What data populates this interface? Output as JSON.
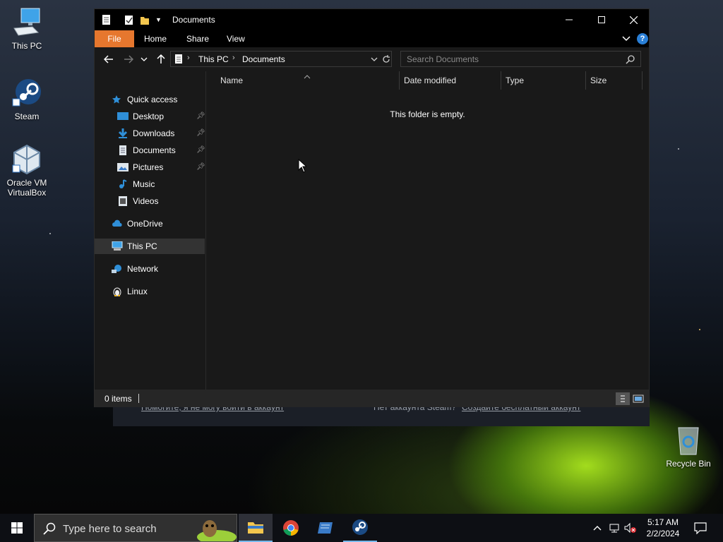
{
  "desktop": {
    "icons": [
      {
        "label": "This PC"
      },
      {
        "label": "Steam"
      },
      {
        "label": "Oracle VM VirtualBox"
      },
      {
        "label": "Recycle Bin"
      }
    ]
  },
  "steam_background": {
    "help_link": "Помогите, я не могу войти в аккаунт",
    "no_account_text": "Нет аккаунта Steam?",
    "create_account_link": "Создайте бесплатный аккаунт"
  },
  "explorer": {
    "title": "Documents",
    "ribbon_tabs": [
      "File",
      "Home",
      "Share",
      "View"
    ],
    "address": {
      "crumbs": [
        "This PC",
        "Documents"
      ]
    },
    "search": {
      "placeholder": "Search Documents"
    },
    "nav_pane": {
      "quick_access": "Quick access",
      "items": [
        {
          "label": "Desktop",
          "pinned": true
        },
        {
          "label": "Downloads",
          "pinned": true
        },
        {
          "label": "Documents",
          "pinned": true
        },
        {
          "label": "Pictures",
          "pinned": true
        },
        {
          "label": "Music",
          "pinned": false
        },
        {
          "label": "Videos",
          "pinned": false
        }
      ],
      "onedrive": "OneDrive",
      "this_pc": "This PC",
      "network": "Network",
      "linux": "Linux"
    },
    "columns": [
      "Name",
      "Date modified",
      "Type",
      "Size"
    ],
    "empty_message": "This folder is empty.",
    "status": {
      "items": "0 items"
    }
  },
  "taskbar": {
    "search_placeholder": "Type here to search",
    "clock": {
      "time": "5:17 AM",
      "date": "2/2/2024"
    }
  },
  "colors": {
    "file_tab": "#e6772e",
    "accent": "#76b9ed",
    "window_bg": "#191919"
  }
}
